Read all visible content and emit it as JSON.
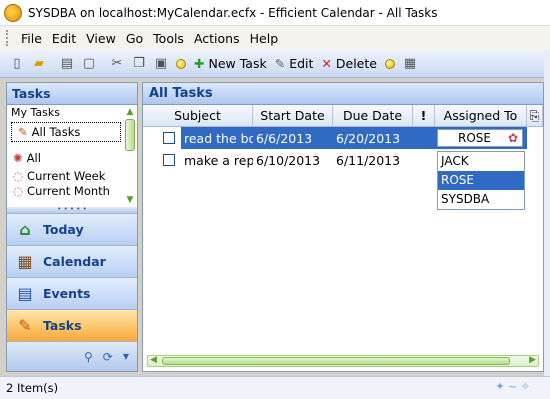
{
  "window": {
    "title": "SYSDBA on localhost:MyCalendar.ecfx - Efficient Calendar - All Tasks"
  },
  "menu": [
    "File",
    "Edit",
    "View",
    "Go",
    "Tools",
    "Actions",
    "Help"
  ],
  "toolbar": {
    "new_task": "New Task",
    "edit": "Edit",
    "delete": "Delete"
  },
  "nav": {
    "header": "Tasks",
    "group": "My Tasks",
    "items": [
      "All Tasks",
      "All",
      "Current Week",
      "Current Month"
    ],
    "buttons": [
      "Today",
      "Calendar",
      "Events",
      "Tasks"
    ]
  },
  "main": {
    "title": "All Tasks",
    "columns": [
      "Subject",
      "Start Date",
      "Due Date",
      "!",
      "Assigned To"
    ],
    "rows": [
      {
        "subject": "read the bo",
        "start": "6/6/2013",
        "due": "6/20/2013",
        "assigned": "ROSE"
      },
      {
        "subject": "make a rep",
        "start": "6/10/2013",
        "due": "6/11/2013",
        "assigned": ""
      }
    ],
    "dropdown_options": [
      "JACK",
      "ROSE",
      "SYSDBA"
    ],
    "dropdown_selected": "ROSE"
  },
  "status": {
    "text": "2 Item(s)"
  }
}
